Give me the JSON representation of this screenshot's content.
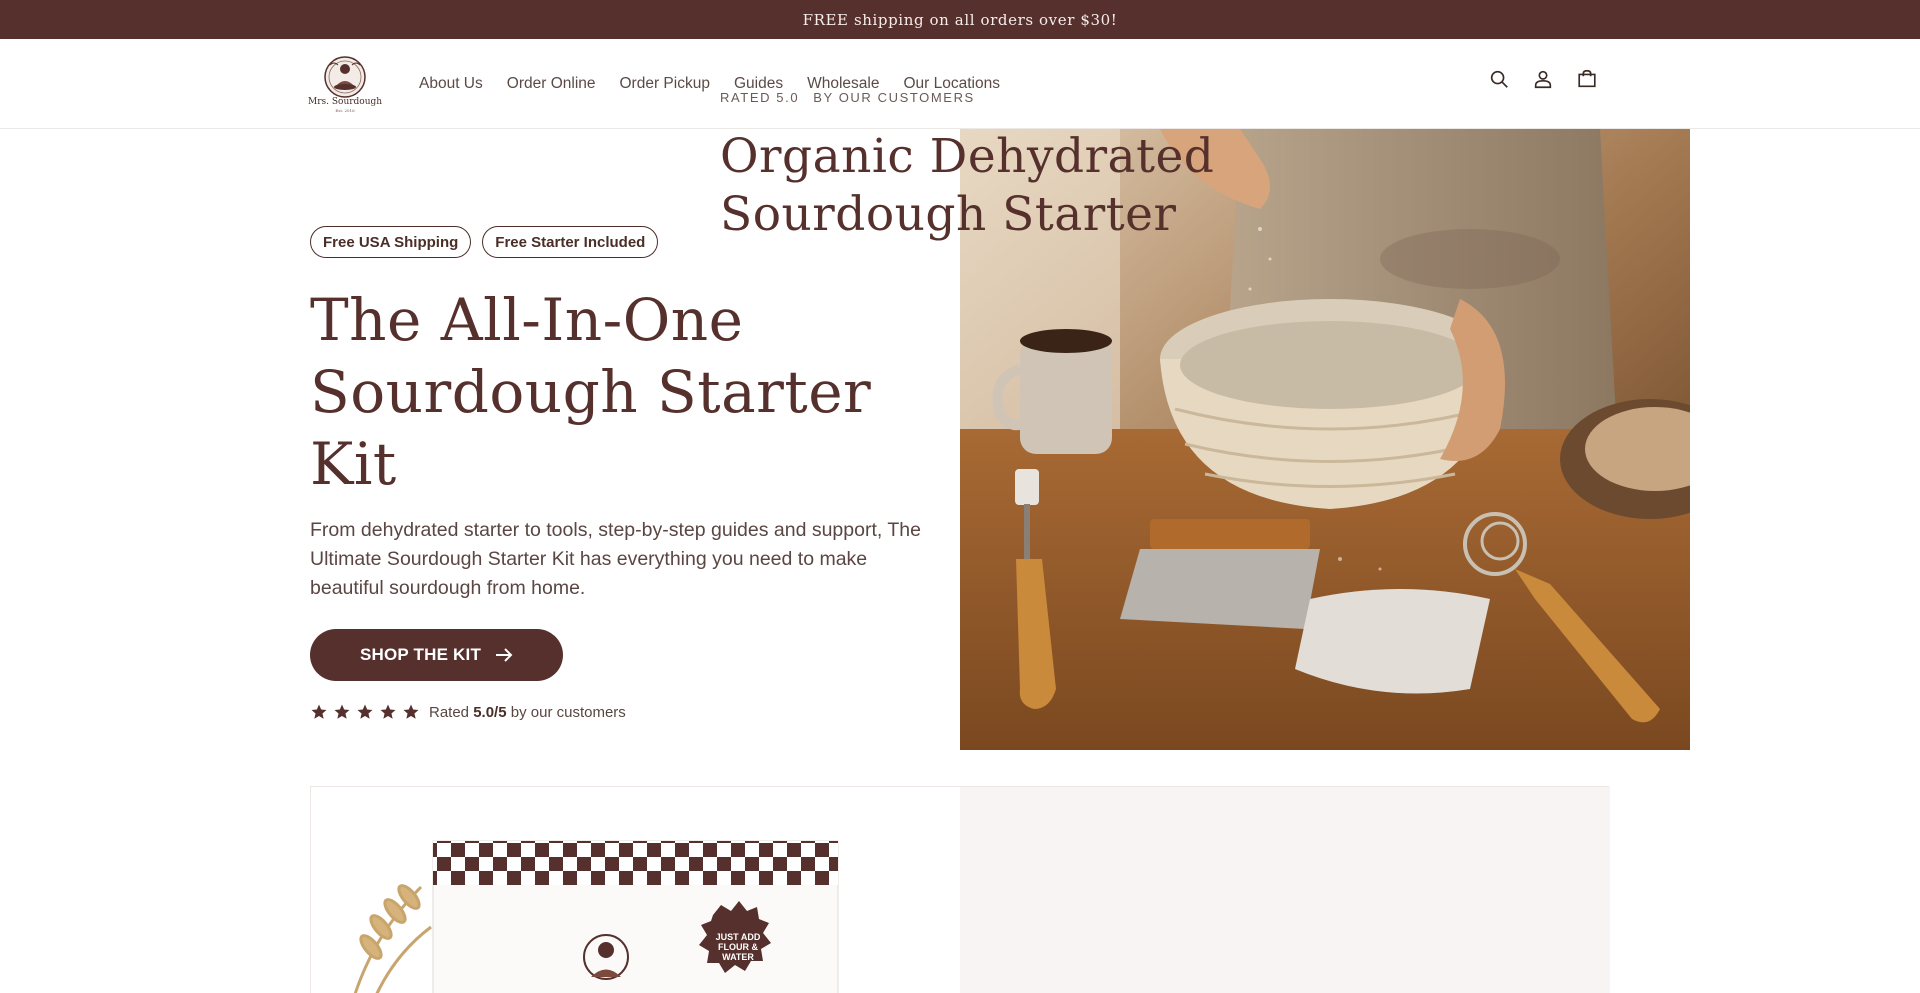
{
  "announcement": {
    "text": "FREE shipping on all orders over $30!"
  },
  "header": {
    "logo_text": "Mrs. Sourdough",
    "logo_sub": "Est. 2016",
    "nav": [
      "About Us",
      "Order Online",
      "Order Pickup",
      "Guides",
      "Wholesale",
      "Our Locations"
    ],
    "icons": [
      "search-icon",
      "account-icon",
      "cart-icon"
    ]
  },
  "hero": {
    "badges": [
      "Free USA Shipping",
      "Free Starter Included"
    ],
    "title_line1": "The All-In-One",
    "title_line2": "Sourdough Starter Kit",
    "description": "From dehydrated starter to tools, step-by-step guides and support, The Ultimate Sourdough Starter Kit has everything you need to make beautiful sourdough from home.",
    "button_label": "SHOP THE KIT",
    "rating": {
      "stars": 5,
      "prefix": "Rated",
      "score": "5.0/5",
      "suffix": "by our customers"
    }
  },
  "product_card": {
    "kicker_rating": "RATED 5.0",
    "kicker_by": "BY OUR CUSTOMERS",
    "title": "Organic Dehydrated Sourdough Starter",
    "badge_text": "JUST ADD FLOUR & WATER"
  },
  "colors": {
    "brand": "#55302c",
    "text": "#4a2e27",
    "muted": "#5a4642",
    "card_bg": "#f7f4f3"
  }
}
